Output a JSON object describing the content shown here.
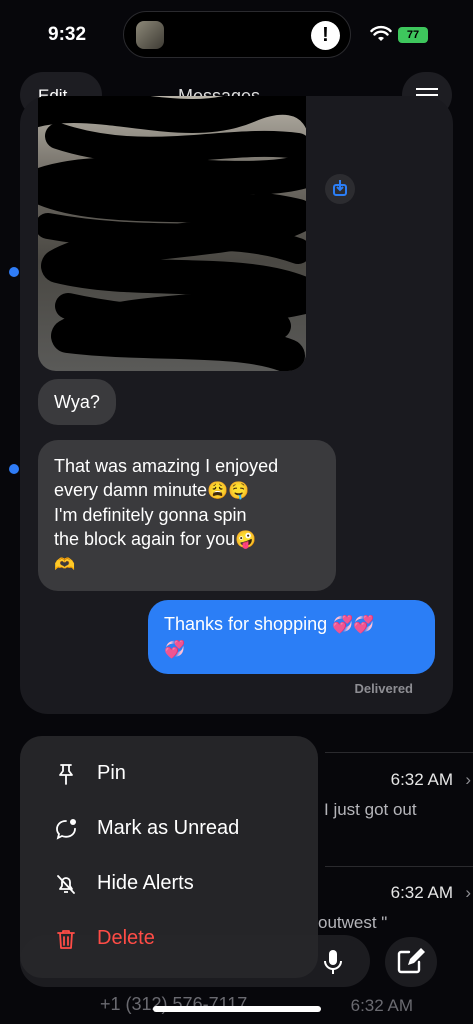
{
  "status_bar": {
    "time": "9:32",
    "battery": "77"
  },
  "island": {
    "alert_glyph": "!"
  },
  "nav": {
    "edit_label": "Edit",
    "title": "Messages"
  },
  "list_rows": [
    {
      "time": "6:32 AM",
      "snippet": "I just got out"
    },
    {
      "time": "6:32 AM",
      "snippet": "outwest \""
    }
  ],
  "bottom_row": {
    "number": "+1 (312) 576-7117",
    "time": "6:32 AM"
  },
  "preview": {
    "messages": [
      {
        "direction": "incoming",
        "text": "Wya?"
      },
      {
        "direction": "incoming",
        "lines": [
          "That was amazing I enjoyed",
          "every damn minute",
          "I'm definitely gonna spin",
          "the block again for you"
        ],
        "emojis": [
          "😩",
          "🤤",
          "🤪",
          "🫶"
        ]
      },
      {
        "direction": "outgoing",
        "text": "Thanks for shopping",
        "emojis": [
          "💞",
          "💞",
          "💞"
        ]
      }
    ],
    "status": "Delivered"
  },
  "context_menu": {
    "items": [
      {
        "label": "Pin",
        "icon": "pin-icon"
      },
      {
        "label": "Mark as Unread",
        "icon": "mark-unread-icon"
      },
      {
        "label": "Hide Alerts",
        "icon": "bell-slash-icon"
      },
      {
        "label": "Delete",
        "icon": "trash-icon",
        "color": "#ff4c46"
      }
    ]
  },
  "colors": {
    "accent": "#2b7ef6",
    "incoming_bubble": "#3a3a3d",
    "destructive": "#ff4c46"
  }
}
